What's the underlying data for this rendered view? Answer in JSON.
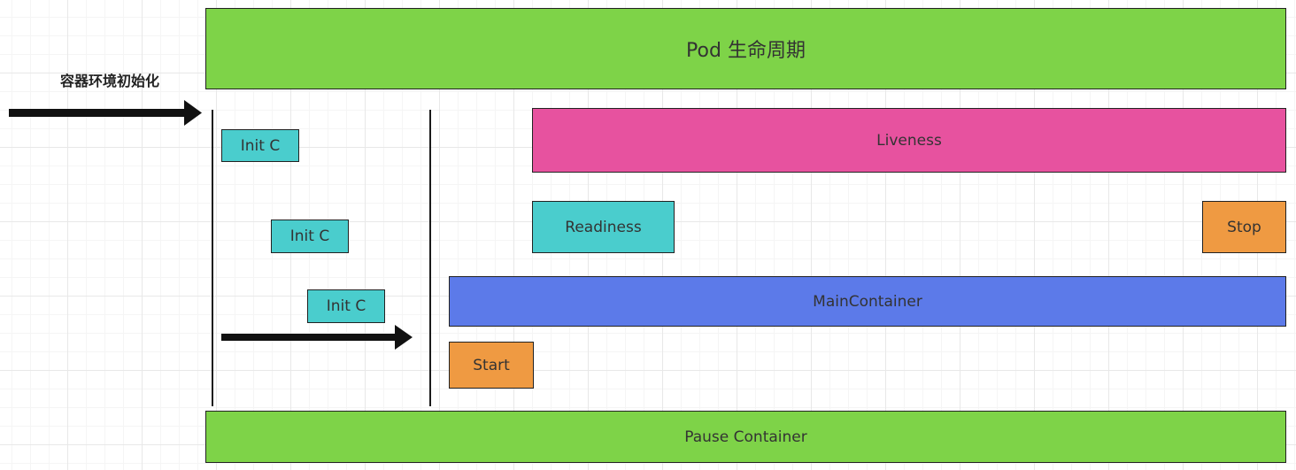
{
  "diagram": {
    "pod_lifecycle_label": "Pod 生命周期",
    "env_init_label": "容器环境初始化",
    "init_containers": [
      "Init C",
      "Init C",
      "Init C"
    ],
    "liveness_label": "Liveness",
    "readiness_label": "Readiness",
    "stop_label": "Stop",
    "main_container_label": "MainContainer",
    "start_label": "Start",
    "pause_container_label": "Pause Container"
  },
  "colors": {
    "green": "#7ED348",
    "pink": "#E7529F",
    "cyan": "#4ACDCD",
    "orange": "#EF9A42",
    "blue": "#5C7AE9",
    "arrow": "#111111"
  }
}
